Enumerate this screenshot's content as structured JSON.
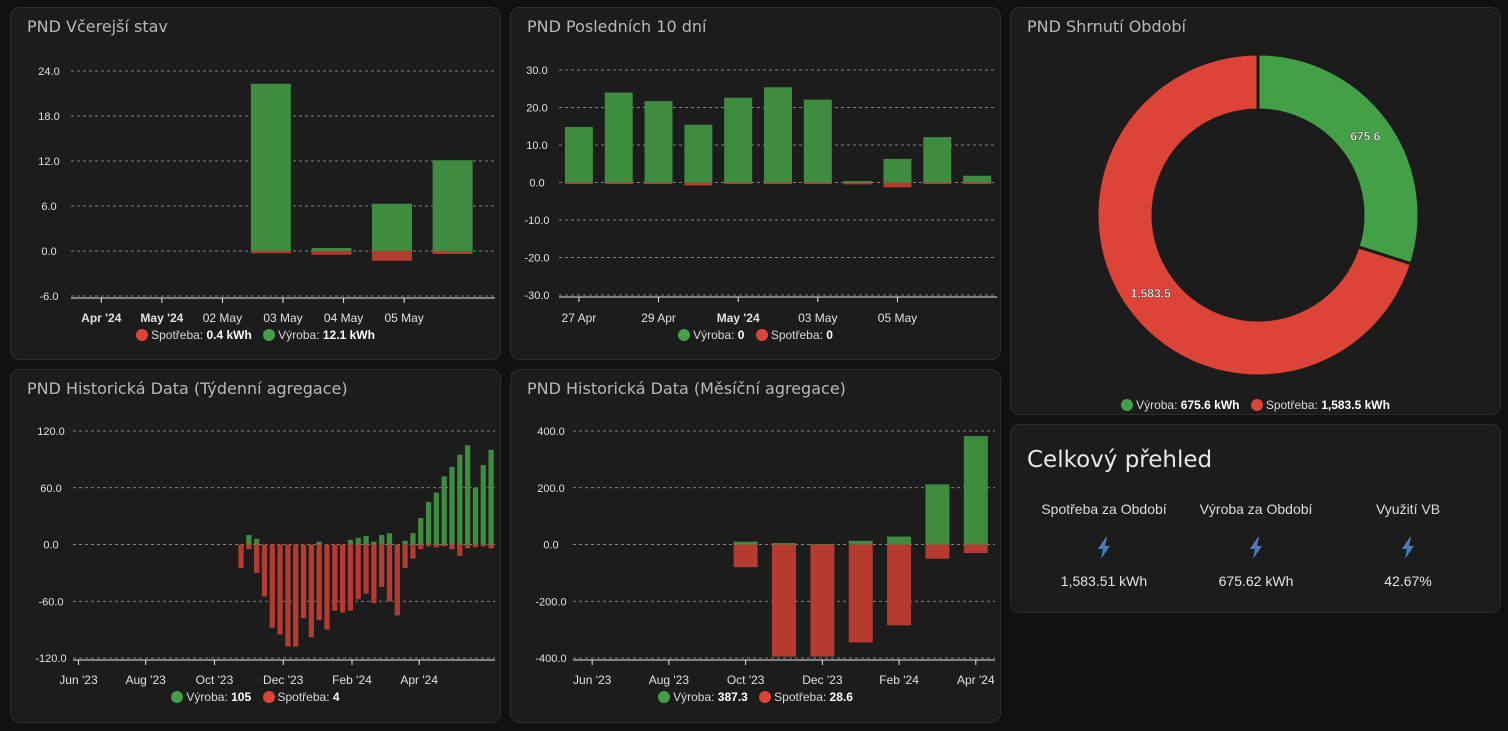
{
  "colors": {
    "green": "#43a047",
    "red": "#db4437",
    "green_bar": "#3d8c40",
    "red_bar": "#b53a30",
    "grid": "#d0d0d0",
    "axis_text": "#e0e0e0",
    "bolt": "#4d7bbf"
  },
  "cards": {
    "yesterday": {
      "title": "PND Včerejší stav",
      "legend": [
        {
          "name": "Spotřeba",
          "value": "0.4 kWh",
          "color": "#db4437"
        },
        {
          "name": "Výroba",
          "value": "12.1 kWh",
          "color": "#43a047"
        }
      ]
    },
    "last10": {
      "title": "PND Posledních 10 dní",
      "legend": [
        {
          "name": "Výroba",
          "value": "0",
          "color": "#43a047"
        },
        {
          "name": "Spotřeba",
          "value": "0",
          "color": "#db4437"
        }
      ]
    },
    "summary_donut": {
      "title": "PND Shrnutí Období",
      "legend": [
        {
          "name": "Výroba",
          "value": "675.6 kWh",
          "color": "#43a047"
        },
        {
          "name": "Spotřeba",
          "value": "1,583.5 kWh",
          "color": "#db4437"
        }
      ]
    },
    "weekly": {
      "title": "PND Historická Data (Týdenní agregace)",
      "legend": [
        {
          "name": "Výroba",
          "value": "105",
          "color": "#43a047"
        },
        {
          "name": "Spotřeba",
          "value": "4",
          "color": "#db4437"
        }
      ]
    },
    "monthly": {
      "title": "PND Historická Data (Měsíční agregace)",
      "legend": [
        {
          "name": "Výroba",
          "value": "387.3",
          "color": "#43a047"
        },
        {
          "name": "Spotřeba",
          "value": "28.6",
          "color": "#db4437"
        }
      ]
    },
    "overview": {
      "title": "Celkový přehled",
      "stats": [
        {
          "label": "Spotřeba za Období",
          "icon": "lightning-bolt-icon",
          "value": "1,583.51 kWh"
        },
        {
          "label": "Výroba za Období",
          "icon": "lightning-bolt-icon",
          "value": "675.62 kWh"
        },
        {
          "label": "Využití VB",
          "icon": "lightning-bolt-icon",
          "value": "42.67%"
        }
      ]
    }
  },
  "chart_data": [
    {
      "id": "yesterday",
      "type": "bar",
      "ylim": [
        -6,
        24
      ],
      "yticks": [
        "24.0",
        "18.0",
        "12.0",
        "6.0",
        "0.0",
        "-6.0"
      ],
      "xticks": [
        {
          "label": "Apr '24",
          "bold": true,
          "at": 0
        },
        {
          "label": "May '24",
          "bold": true,
          "at": 1
        },
        {
          "label": "02 May",
          "bold": false,
          "at": 2
        },
        {
          "label": "03 May",
          "bold": false,
          "at": 3
        },
        {
          "label": "04 May",
          "bold": false,
          "at": 4
        },
        {
          "label": "05 May",
          "bold": false,
          "at": 5
        }
      ],
      "x_slots": 7,
      "series": [
        {
          "name": "Výroba",
          "values": [
            0,
            0,
            0,
            22.3,
            0.4,
            6.3,
            12.1
          ]
        },
        {
          "name": "Spotřeba",
          "values": [
            0,
            0,
            0,
            -0.3,
            -0.5,
            -1.3,
            -0.4
          ]
        }
      ]
    },
    {
      "id": "last10",
      "type": "bar",
      "ylim": [
        -30,
        30
      ],
      "yticks": [
        "30.0",
        "20.0",
        "10.0",
        "0.0",
        "-10.0",
        "-20.0",
        "-30.0"
      ],
      "xticks": [
        {
          "label": "27 Apr",
          "bold": false,
          "at": 0
        },
        {
          "label": "29 Apr",
          "bold": false,
          "at": 2
        },
        {
          "label": "May '24",
          "bold": true,
          "at": 4
        },
        {
          "label": "03 May",
          "bold": false,
          "at": 6
        },
        {
          "label": "05 May",
          "bold": false,
          "at": 8
        }
      ],
      "x_slots": 11,
      "series": [
        {
          "name": "Výroba",
          "values": [
            14.8,
            24,
            21.7,
            15.4,
            22.6,
            25.4,
            22.1,
            0.4,
            6.3,
            12.1,
            1.8
          ]
        },
        {
          "name": "Spotřeba",
          "values": [
            -0.3,
            -0.3,
            -0.3,
            -0.8,
            -0.3,
            -0.3,
            -0.3,
            -0.5,
            -1.3,
            -0.4,
            -0.3
          ]
        }
      ]
    },
    {
      "id": "summary_donut",
      "type": "pie",
      "slices": [
        {
          "name": "Výroba",
          "value": 675.6,
          "label": "675.6"
        },
        {
          "name": "Spotřeba",
          "value": 1583.5,
          "label": "1,583.5"
        }
      ]
    },
    {
      "id": "weekly",
      "type": "bar",
      "ylim": [
        -120,
        120
      ],
      "yticks": [
        "120.0",
        "60.0",
        "0.0",
        "-60.0",
        "-120.0"
      ],
      "xticks": [
        {
          "label": "Jun '23",
          "bold": false,
          "at": 0.2
        },
        {
          "label": "Aug '23",
          "bold": false,
          "at": 8.8
        },
        {
          "label": "Oct '23",
          "bold": false,
          "at": 17.6
        },
        {
          "label": "Dec '23",
          "bold": false,
          "at": 26.4
        },
        {
          "label": "Feb '24",
          "bold": false,
          "at": 35.2
        },
        {
          "label": "Apr '24",
          "bold": false,
          "at": 43.8
        }
      ],
      "x_slots": 54,
      "start_index": 21,
      "series": [
        {
          "name": "Výroba",
          "values": [
            0,
            10,
            6,
            0,
            0,
            0,
            0,
            0,
            0,
            0,
            3,
            0,
            0,
            0,
            5,
            7,
            9,
            3,
            10,
            12,
            0,
            4,
            12,
            28,
            45,
            55,
            72,
            82,
            95,
            105,
            60,
            84,
            100
          ]
        },
        {
          "name": "Spotřeba",
          "values": [
            -25,
            -5,
            -30,
            -55,
            -88,
            -95,
            -108,
            -108,
            -78,
            -98,
            -80,
            -90,
            -70,
            -72,
            -70,
            -58,
            -52,
            -62,
            -45,
            -60,
            -75,
            -25,
            -15,
            -5,
            -2,
            -3,
            -2,
            -5,
            -12,
            -4,
            -3,
            -2,
            -4
          ]
        }
      ]
    },
    {
      "id": "monthly",
      "type": "bar",
      "ylim": [
        -400,
        400
      ],
      "yticks": [
        "400.0",
        "200.0",
        "0.0",
        "-200.0",
        "-400.0"
      ],
      "xticks": [
        {
          "label": "Jun '23",
          "bold": false,
          "at": 0
        },
        {
          "label": "Aug '23",
          "bold": false,
          "at": 2
        },
        {
          "label": "Oct '23",
          "bold": false,
          "at": 4
        },
        {
          "label": "Dec '23",
          "bold": false,
          "at": 6
        },
        {
          "label": "Feb '24",
          "bold": false,
          "at": 8
        },
        {
          "label": "Apr '24",
          "bold": false,
          "at": 10
        }
      ],
      "x_slots": 11,
      "series": [
        {
          "name": "Výroba",
          "values": [
            0,
            0,
            0,
            0,
            10,
            5,
            2,
            13,
            28,
            212,
            382
          ]
        },
        {
          "name": "Spotřeba",
          "values": [
            0,
            0,
            0,
            0,
            -80,
            -395,
            -395,
            -345,
            -285,
            -50,
            -30
          ]
        }
      ]
    }
  ]
}
